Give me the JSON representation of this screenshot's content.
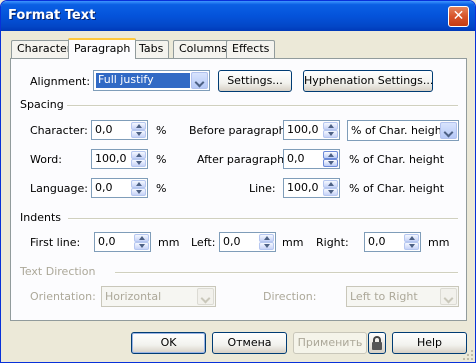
{
  "window": {
    "title": "Format Text",
    "close_glyph": "✕"
  },
  "tabs": [
    {
      "label": "Character"
    },
    {
      "label": "Paragraph",
      "active": true
    },
    {
      "label": "Tabs"
    },
    {
      "label": "Columns"
    },
    {
      "label": "Effects"
    }
  ],
  "alignment": {
    "label": "Alignment:",
    "value": "Full justify",
    "settings_button": "Settings...",
    "hyphenation_button": "Hyphenation Settings..."
  },
  "spacing": {
    "title": "Spacing",
    "character": {
      "label": "Character:",
      "value": "0,0",
      "unit": "%"
    },
    "word": {
      "label": "Word:",
      "value": "100,0",
      "unit": "%"
    },
    "language": {
      "label": "Language:",
      "value": "0,0",
      "unit": "%"
    },
    "before_paragraph": {
      "label": "Before paragraph:",
      "value": "100,0",
      "unit": "% of Char. height"
    },
    "after_paragraph": {
      "label": "After paragraph:",
      "value": "0,0",
      "unit": "% of Char. height"
    },
    "line": {
      "label": "Line:",
      "value": "100,0",
      "unit": "% of Char. height"
    }
  },
  "indents": {
    "title": "Indents",
    "first_line": {
      "label": "First line:",
      "value": "0,0",
      "unit": "mm"
    },
    "left": {
      "label": "Left:",
      "value": "0,0",
      "unit": "mm"
    },
    "right": {
      "label": "Right:",
      "value": "0,0",
      "unit": "mm"
    }
  },
  "text_direction": {
    "title": "Text Direction",
    "orientation": {
      "label": "Orientation:",
      "value": "Horizontal"
    },
    "direction": {
      "label": "Direction:",
      "value": "Left to Right"
    }
  },
  "buttons": {
    "ok": "OK",
    "cancel": "Отмена",
    "apply": "Применить",
    "help": "Help"
  },
  "colors": {
    "titlebar": "#0453da",
    "dialog_bg": "#ece9d8",
    "panel_bg": "#fcfcfe",
    "selection": "#316ac5",
    "active_tab_accent": "#ffc83c"
  }
}
